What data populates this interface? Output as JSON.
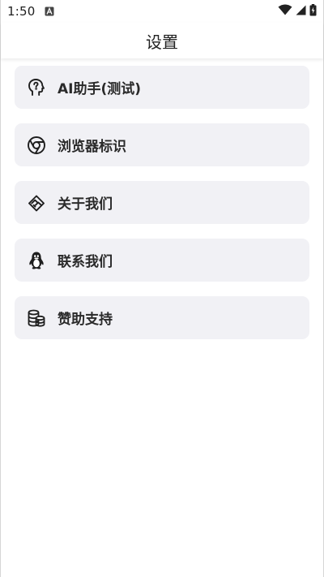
{
  "status_bar": {
    "time": "1:50",
    "notification_icon": "a-notification-icon",
    "wifi_icon": "wifi-icon",
    "signal_icon": "cell-signal-icon",
    "battery_icon": "battery-charging-icon"
  },
  "app_bar": {
    "title": "设置"
  },
  "menu": {
    "items": [
      {
        "label": "AI助手(测试)",
        "icon": "ai-head-icon"
      },
      {
        "label": "浏览器标识",
        "icon": "chrome-icon"
      },
      {
        "label": "关于我们",
        "icon": "diamond-handshake-icon"
      },
      {
        "label": "联系我们",
        "icon": "penguin-icon"
      },
      {
        "label": "赞助支持",
        "icon": "coins-icon"
      }
    ]
  },
  "colors": {
    "item_background": "#f1f1f5",
    "text": "#2a2a2a",
    "background": "#ffffff"
  }
}
